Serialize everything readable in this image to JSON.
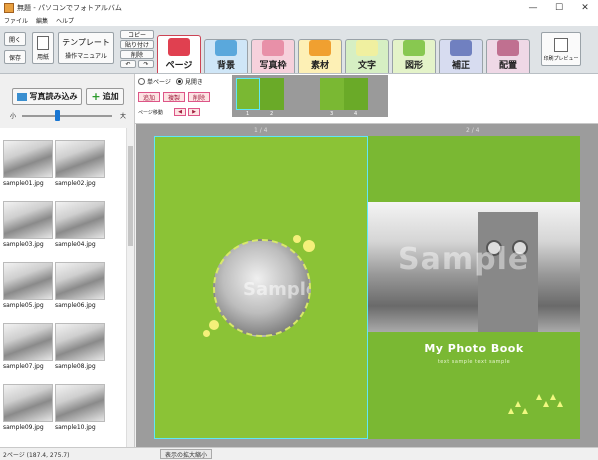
{
  "titlebar": {
    "title": "無題 - パソコンでフォトアルバム"
  },
  "menu": {
    "items": [
      "ファイル",
      "編集",
      "ヘルプ"
    ]
  },
  "ribbon": {
    "open_label": "開く",
    "save_label": "保存",
    "paper_label": "用紙",
    "template_label": "テンプレート",
    "manual_label": "操作マニュアル",
    "copy_label": "コピー",
    "paste_label": "貼り付け",
    "delete_label": "削除",
    "print_preview_label": "印刷プレビュー",
    "tabs": [
      {
        "label": "ページ",
        "color": "#ffffff",
        "icon": "book-icon"
      },
      {
        "label": "背景",
        "color": "#cfe6f7",
        "icon": "background-icon"
      },
      {
        "label": "写真枠",
        "color": "#f6d1dc",
        "icon": "photo-frame-icon"
      },
      {
        "label": "素材",
        "color": "#fdf0b5",
        "icon": "material-icon"
      },
      {
        "label": "文字",
        "color": "#d6efc3",
        "icon": "text-icon"
      },
      {
        "label": "図形",
        "color": "#e4f3c9",
        "icon": "shape-icon"
      },
      {
        "label": "補正",
        "color": "#d7dcf0",
        "icon": "correction-icon"
      },
      {
        "label": "配置",
        "color": "#efd8e6",
        "icon": "layout-icon"
      }
    ]
  },
  "left_tools": {
    "import_label": "写真読み込み",
    "add_label": "追加",
    "size_small": "小",
    "size_large": "大",
    "thumb_size_fraction": 0.4
  },
  "page_ctrl": {
    "single_label": "単ページ",
    "spread_label": "見開き",
    "selected": "見開き",
    "add_label": "追加",
    "copy_label": "複製",
    "delete_label": "削除",
    "move_label": "ページ移動"
  },
  "thumbnails": {
    "pages": [
      "1",
      "2",
      "3",
      "4"
    ]
  },
  "photos": [
    {
      "name": "sample01.jpg"
    },
    {
      "name": "sample02.jpg"
    },
    {
      "name": "sample03.jpg"
    },
    {
      "name": "sample04.jpg"
    },
    {
      "name": "sample05.jpg"
    },
    {
      "name": "sample06.jpg"
    },
    {
      "name": "sample07.jpg"
    },
    {
      "name": "sample08.jpg"
    },
    {
      "name": "sample09.jpg"
    },
    {
      "name": "sample10.jpg"
    }
  ],
  "canvas": {
    "left_page_num": "1 / 4",
    "right_page_num": "2 / 4",
    "watermark_left": "Sample",
    "watermark_right": "Sample",
    "book_title": "My Photo Book",
    "book_subtitle": "text sample text sample",
    "accent_green": "#8bc336"
  },
  "status": {
    "coords": "2ページ (187.4, 275.7)",
    "zoom_label": "表示の拡大縮小"
  }
}
